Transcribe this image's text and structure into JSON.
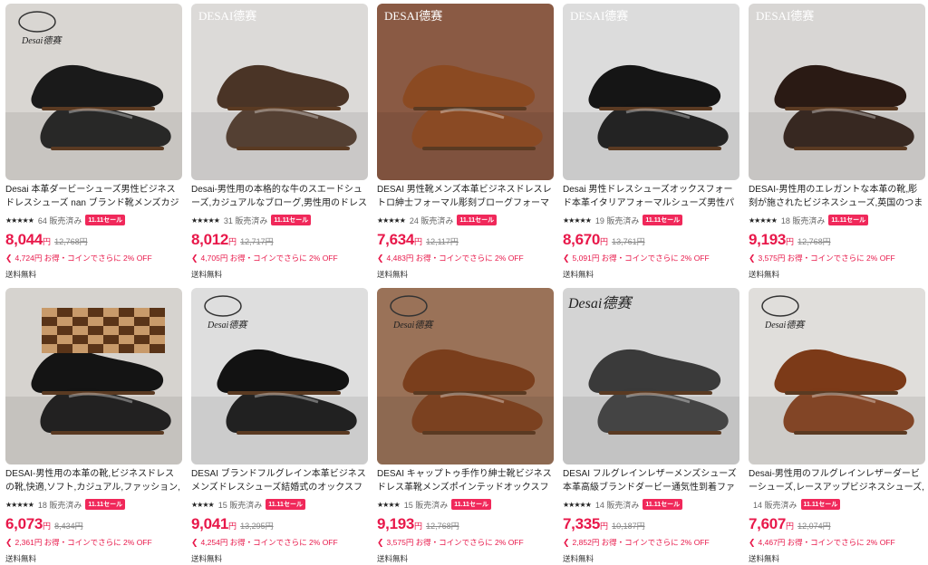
{
  "products": [
    {
      "title": "Desai 本革ダービーシューズ男性ビジネスドレスシューズ nan ブランド靴メンズカジュアルシュー...",
      "stars": "★★★★★",
      "sold": "64 販売済み",
      "sale": "11.11セール",
      "price": "8,044",
      "yen": "円",
      "original": "12,768円",
      "coupon": "4,724円 お得・コインでさらに 2% OFF",
      "shipping": "送料無料",
      "bg": "#d9d6d2",
      "shoe": "#1a1a1a",
      "icon": "desai-logo-icon"
    },
    {
      "title": "Desai-男性用の本格的な牛のスエードシューズ,カジュアルなブローグ,男性用のドレスシュー...",
      "stars": "★★★★★",
      "sold": "31 販売済み",
      "sale": "11.11セール",
      "price": "8,012",
      "yen": "円",
      "original": "12,717円",
      "coupon": "4,705円 お得・コインでさらに 2% OFF",
      "shipping": "送料無料",
      "bg": "#dcdad8",
      "shoe": "#4a3426",
      "icon": "desai-text-logo-icon"
    },
    {
      "title": "DESAI 男性靴メンズ本革ビジネスドレスレトロ紳士フォーマル彫刻ブローグフォーマルシューズ...",
      "stars": "★★★★★",
      "sold": "24 販売済み",
      "sale": "11.11セール",
      "price": "7,634",
      "yen": "円",
      "original": "12,117円",
      "coupon": "4,483円 お得・コインでさらに 2% OFF",
      "shipping": "送料無料",
      "bg": "#8a5a44",
      "shoe": "#8b4a22",
      "icon": "desai-text-logo-icon"
    },
    {
      "title": "Desai 男性ドレスシューズオックスフォード本革イタリアフォーマルシューズ男性パーティークラシッ...",
      "stars": "★★★★★",
      "sold": "19 販売済み",
      "sale": "11.11セール",
      "price": "8,670",
      "yen": "円",
      "original": "13,761円",
      "coupon": "5,091円 お得・コインでさらに 2% OFF",
      "shipping": "送料無料",
      "bg": "#dcdcdc",
      "shoe": "#151515",
      "icon": "desai-text-logo-icon"
    },
    {
      "title": "DESAI-男性用のエレガントな本革の靴,彫刻が施されたビジネスシューズ,英国のつま先,クラ...",
      "stars": "★★★★★",
      "sold": "18 販売済み",
      "sale": "11.11セール",
      "price": "9,193",
      "yen": "円",
      "original": "12,768円",
      "coupon": "3,575円 お得・コインでさらに 2% OFF",
      "shipping": "送料無料",
      "bg": "#d8d6d4",
      "shoe": "#2a1a14",
      "icon": "desai-text-logo-icon"
    },
    {
      "title": "DESAI-男性用の本革の靴,ビジネスドレスの靴,快適,ソフト,カジュアル,ファッション,ギフト",
      "stars": "★★★★★",
      "sold": "18 販売済み",
      "sale": "11.11セール",
      "price": "6,073",
      "yen": "円",
      "original": "8,434円",
      "coupon": "2,361円 お得・コインでさらに 2% OFF",
      "shipping": "送料無料",
      "bg": "#d6d3cf",
      "shoe": "#141414",
      "icon": "chessboard-icon"
    },
    {
      "title": "DESAI ブランドフルグレイン本革ビジネスメンズドレスシューズ結婚式のオックスフォードシューズ...",
      "stars": "★★★★",
      "sold": "15 販売済み",
      "sale": "11.11セール",
      "price": "9,041",
      "yen": "円",
      "original": "13,295円",
      "coupon": "4,254円 お得・コインでさらに 2% OFF",
      "shipping": "送料無料",
      "bg": "#dedede",
      "shoe": "#121212",
      "icon": "desai-logo-icon"
    },
    {
      "title": "DESAI キャップトゥ手作り紳士靴ビジネスドレス革靴メンズポインテッドオックスフォードレイズド...",
      "stars": "★★★★",
      "sold": "15 販売済み",
      "sale": "11.11セール",
      "price": "9,193",
      "yen": "円",
      "original": "12,768円",
      "coupon": "3,575円 お得・コインでさらに 2% OFF",
      "shipping": "送料無料",
      "bg": "#9a7258",
      "shoe": "#7a3e1c",
      "icon": "desai-logo-icon"
    },
    {
      "title": "DESAI フルグレインレザーメンズシューズ本革高級ブランドダービー通気性到着ファッションデザ...",
      "stars": "★★★★★",
      "sold": "14 販売済み",
      "sale": "11.11セール",
      "price": "7,335",
      "yen": "円",
      "original": "10,187円",
      "coupon": "2,852円 お得・コインでさらに 2% OFF",
      "shipping": "送料無料",
      "bg": "#d4d4d4",
      "shoe": "#3a3a3a",
      "icon": "desai-script-logo-icon"
    },
    {
      "title": "Desai-男性用のフルグレインレザーダービーシューズ,レースアップビジネスシューズ,ミニマリストシュ...",
      "stars": "",
      "sold": "14 販売済み",
      "sale": "11.11セール",
      "price": "7,607",
      "yen": "円",
      "original": "12,074円",
      "coupon": "4,467円 お得・コインでさらに 2% OFF",
      "shipping": "送料無料",
      "bg": "#e0dedb",
      "shoe": "#7c3a18",
      "icon": "desai-logo-icon"
    }
  ]
}
